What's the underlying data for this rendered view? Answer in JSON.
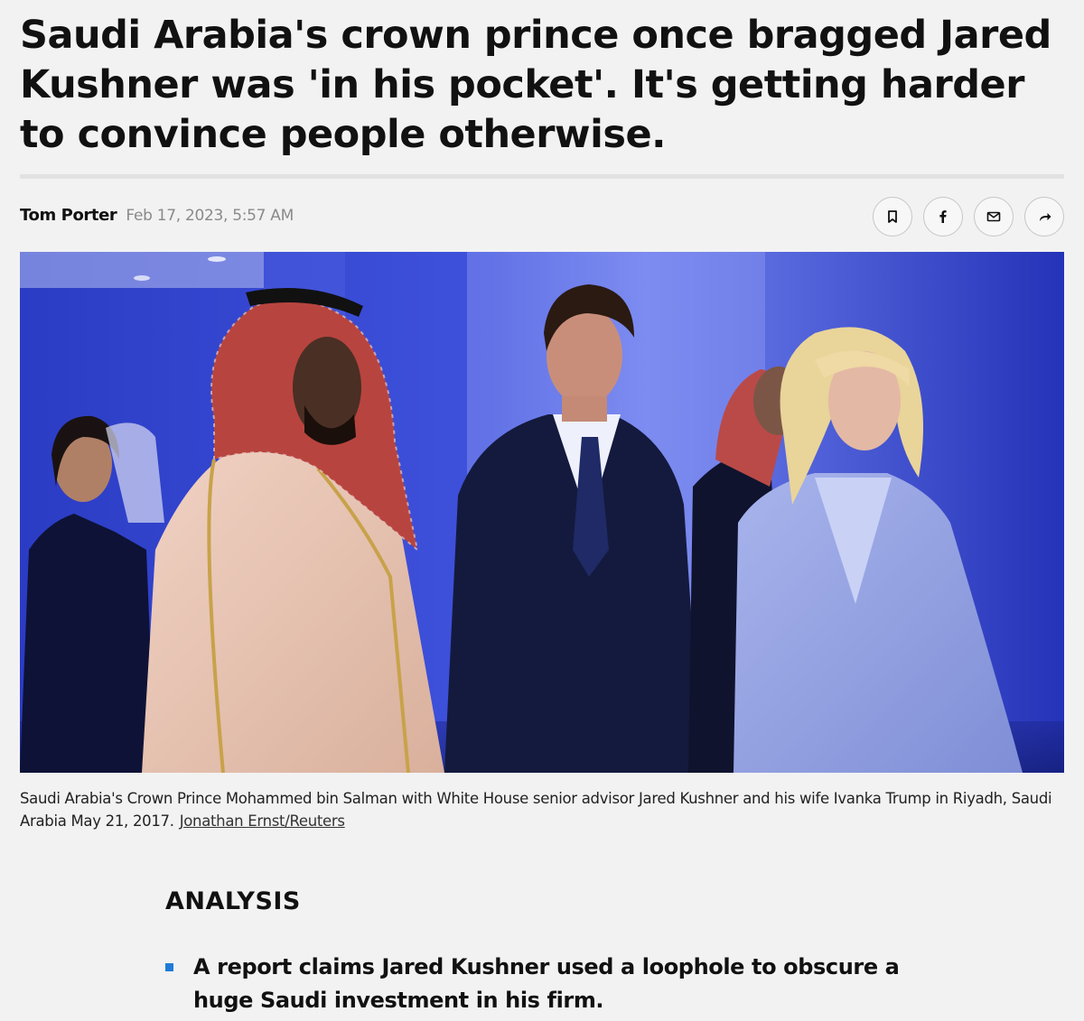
{
  "article": {
    "headline": "Saudi Arabia's crown prince once bragged Jared Kushner was 'in his pocket'. It's getting harder to convince people otherwise.",
    "author": "Tom Porter",
    "date": "Feb 17, 2023, 5:57 AM"
  },
  "share": {
    "icons": [
      "bookmark-icon",
      "facebook-icon",
      "email-icon",
      "share-arrow-icon"
    ],
    "icon_color": "#111111"
  },
  "image": {
    "caption": "Saudi Arabia's Crown Prince Mohammed bin Salman with White House senior advisor Jared Kushner and his wife Ivanka Trump in Riyadh, Saudi Arabia May 21, 2017.",
    "credit": "Jonathan Ernst/Reuters"
  },
  "summary": {
    "label": "ANALYSIS",
    "bullets": [
      "A report claims Jared Kushner used a loophole to obscure a huge Saudi investment in his firm."
    ],
    "bullet_color": "#1f7bd6"
  }
}
